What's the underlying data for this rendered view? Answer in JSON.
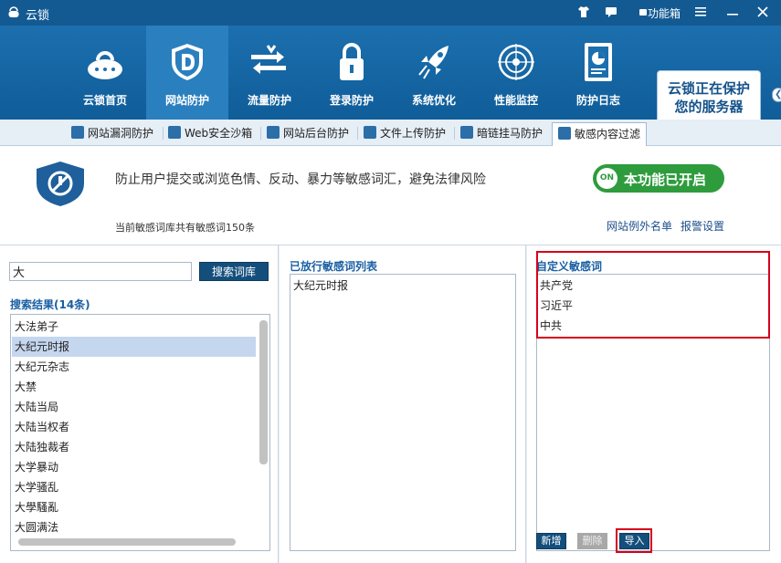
{
  "app": {
    "title": "云锁"
  },
  "titlebar": {
    "toolbox_label": "功能箱"
  },
  "nav": {
    "items": [
      {
        "label": "云锁首页",
        "icon": "cloud-lock-icon"
      },
      {
        "label": "网站防护",
        "icon": "shield-d-icon",
        "active": true
      },
      {
        "label": "流量防护",
        "icon": "traffic-icon"
      },
      {
        "label": "登录防护",
        "icon": "padlock-icon"
      },
      {
        "label": "系统优化",
        "icon": "rocket-icon"
      },
      {
        "label": "性能监控",
        "icon": "radar-icon"
      },
      {
        "label": "防护日志",
        "icon": "report-icon"
      }
    ],
    "status_line1": "云锁正在保护",
    "status_line2": "您的服务器"
  },
  "subtabs": [
    {
      "label": "网站漏洞防护"
    },
    {
      "label": "Web安全沙箱"
    },
    {
      "label": "网站后台防护"
    },
    {
      "label": "文件上传防护"
    },
    {
      "label": "暗链挂马防护"
    },
    {
      "label": "敏感内容过滤",
      "active": true
    }
  ],
  "feature": {
    "description": "防止用户提交或浏览色情、反动、暴力等敏感词汇，避免法律风险",
    "toggle_knob": "ON",
    "toggle_label": "本功能已开启",
    "count_text": "当前敏感词库共有敏感词150条",
    "link_exceptions": "网站例外名单",
    "link_alarm": "报警设置"
  },
  "search": {
    "value": "大",
    "button_label": "搜索词库",
    "results_title": "搜索结果(14条)",
    "results": [
      "大法弟子",
      "大纪元时报",
      "大纪元杂志",
      "大禁",
      "大陆当局",
      "大陆当权者",
      "大陆独裁者",
      "大学暴动",
      "大学骚乱",
      "大學騷亂",
      "大圆满法"
    ],
    "selected_index": 1
  },
  "allowed": {
    "title": "已放行敏感词列表",
    "items": [
      "大纪元时报"
    ]
  },
  "custom": {
    "title": "自定义敏感词",
    "items": [
      "共产党",
      "习近平",
      "中共"
    ],
    "add_label": "新增",
    "delete_label": "删除",
    "import_label": "导入"
  },
  "colors": {
    "titlebar": "#135a93",
    "nav": "#1c6fae",
    "toggle_on": "#2e9c3d",
    "highlight": "#d6001c"
  }
}
